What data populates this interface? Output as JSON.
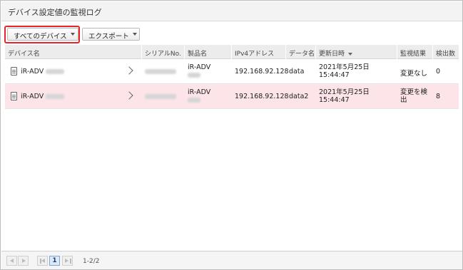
{
  "page": {
    "title": "デバイス設定値の監視ログ"
  },
  "toolbar": {
    "device_filter_label": "すべてのデバイス",
    "export_label": "エクスポート"
  },
  "table": {
    "columns": [
      "デバイス名",
      "シリアルNo.",
      "製品名",
      "IPv4アドレス",
      "データ名",
      "更新日時",
      "監視結果",
      "検出数"
    ],
    "rows": [
      {
        "device_name": "iR-ADV",
        "product_name": "iR-ADV",
        "ipv4": "192.168.92.128",
        "data_name": "data",
        "updated_date": "2021年5月25日",
        "updated_time": "15:44:47",
        "result": "変更なし",
        "result_line2": "",
        "detections": "0"
      },
      {
        "device_name": "iR-ADV",
        "product_name": "iR-ADV",
        "ipv4": "192.168.92.128",
        "data_name": "data2",
        "updated_date": "2021年5月25日",
        "updated_time": "15:44:47",
        "result": "変更を検",
        "result_line2": "出",
        "detections": "8"
      }
    ]
  },
  "pagination": {
    "current_page": "1",
    "range": "1-2/2"
  }
}
